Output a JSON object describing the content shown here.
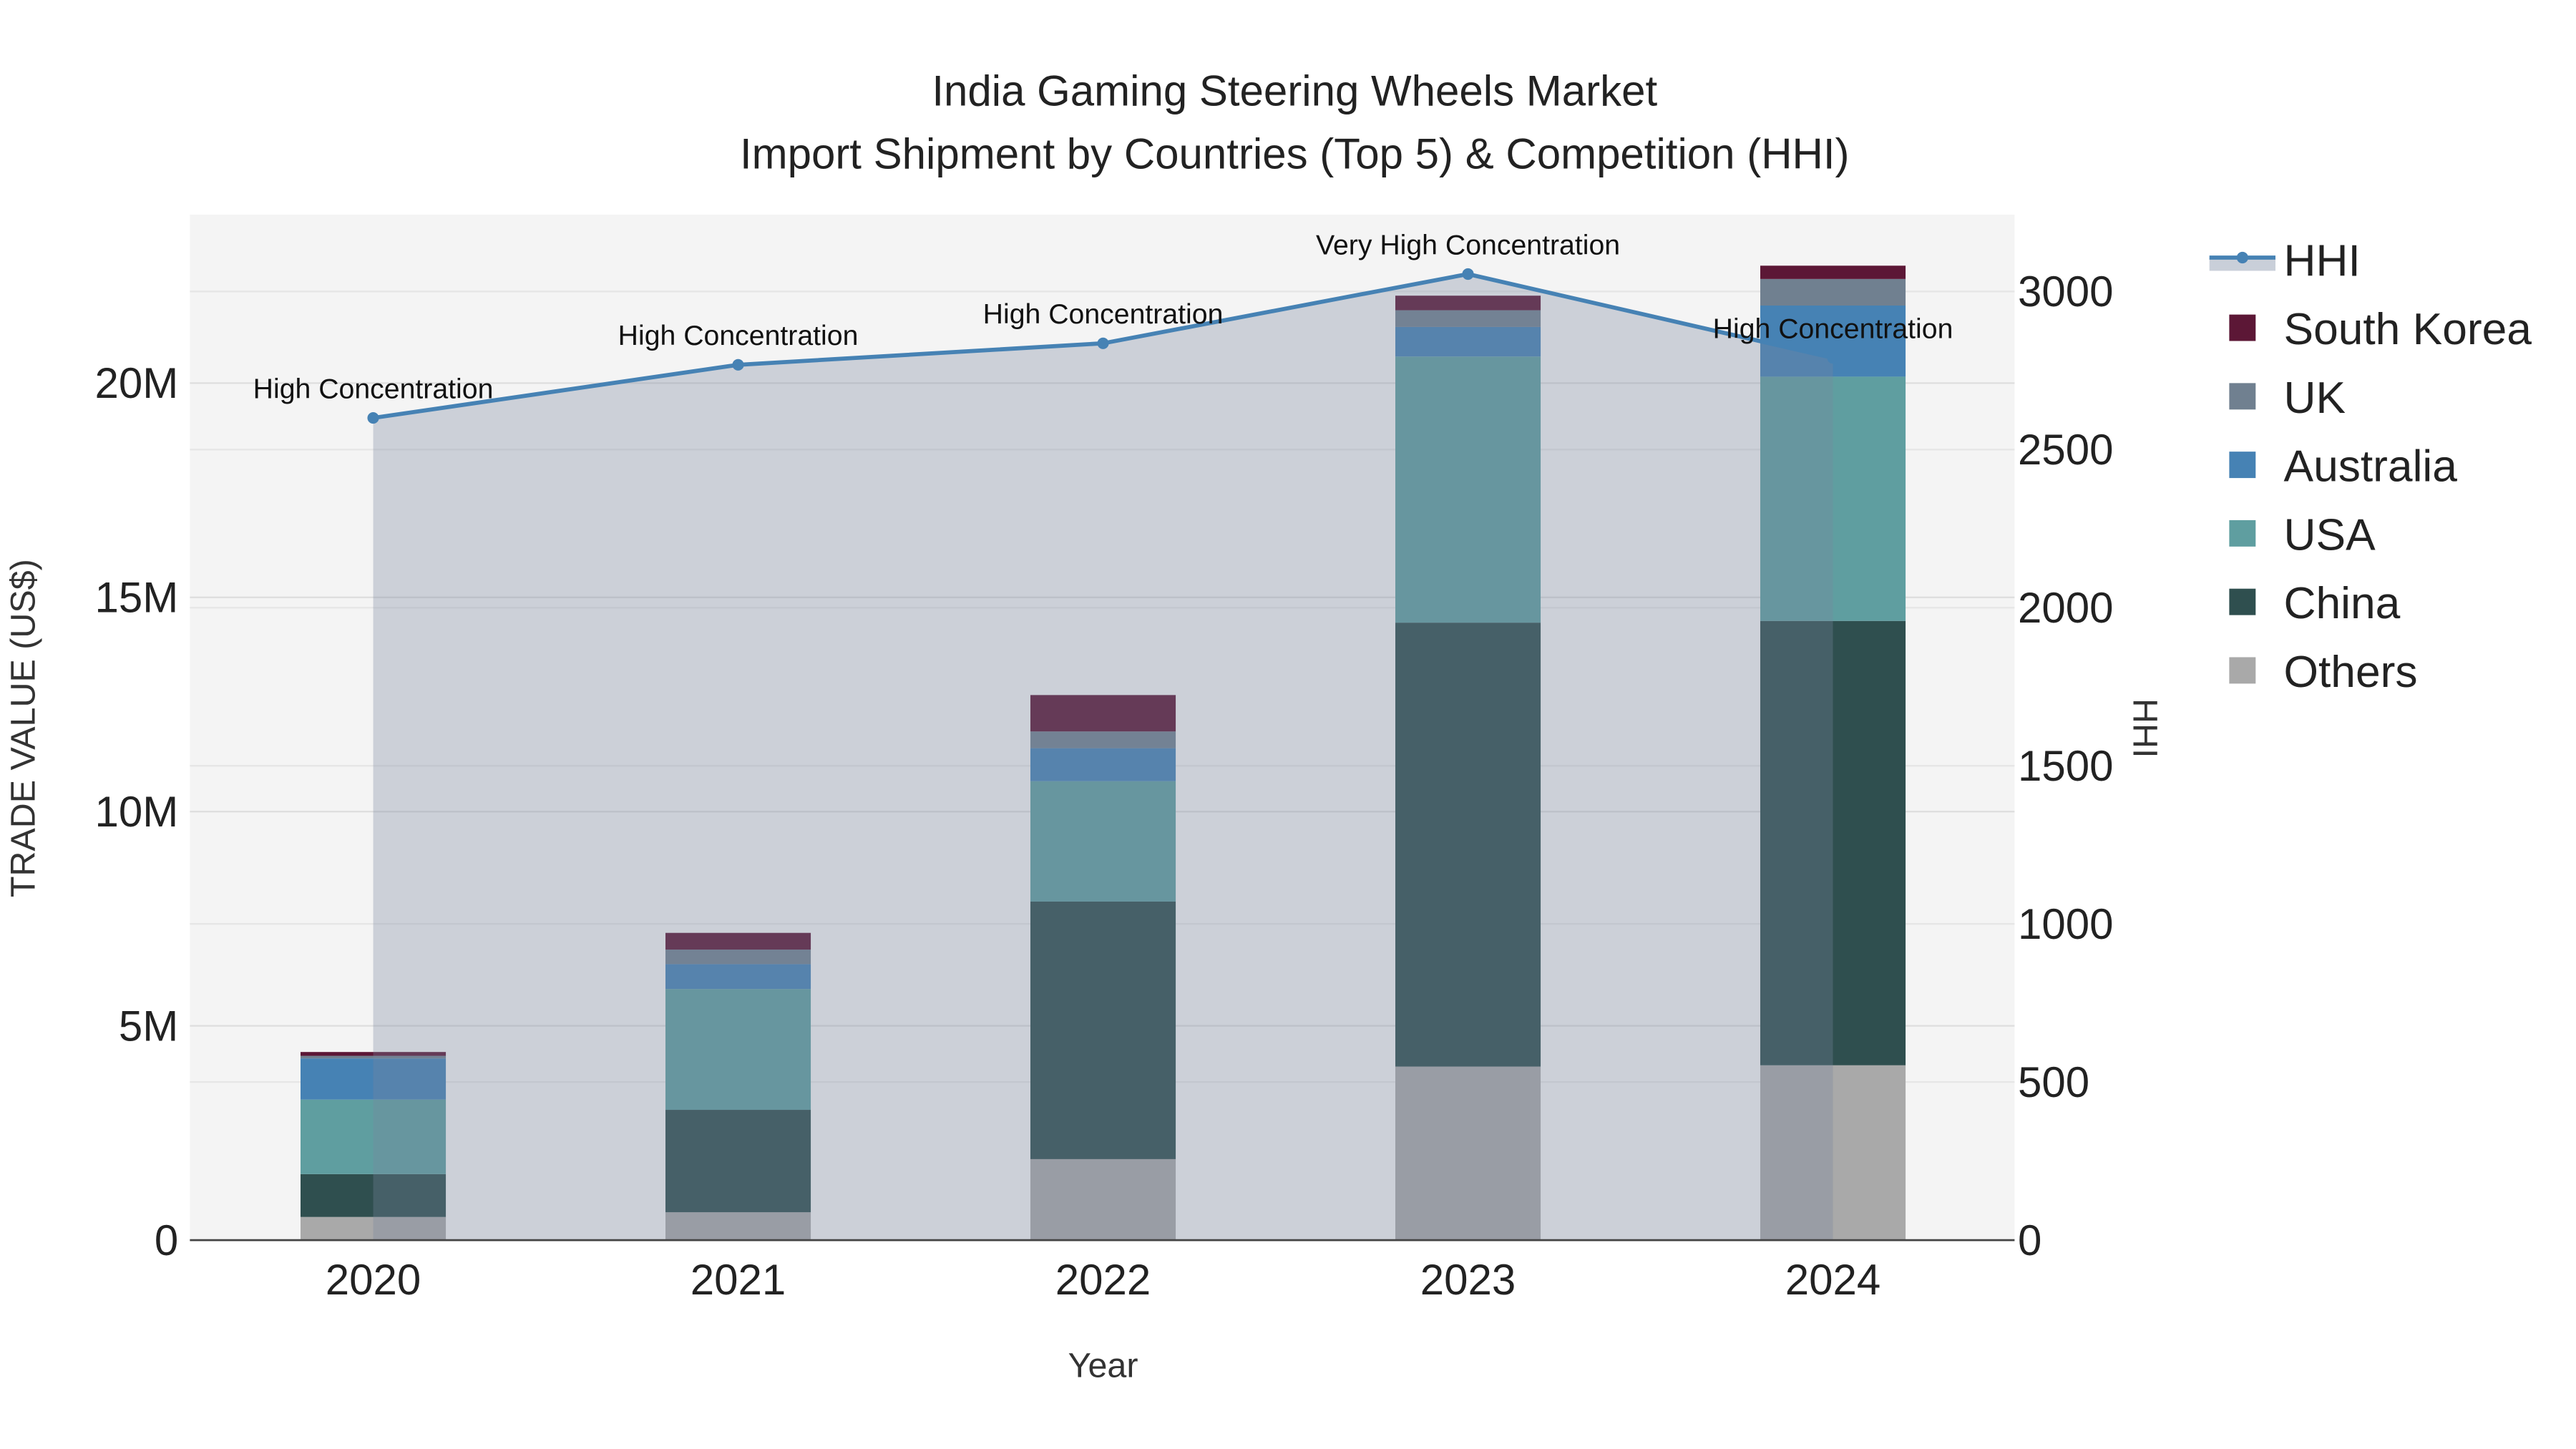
{
  "chart_data": {
    "type": "bar",
    "stacked": true,
    "title": "India Gaming Steering Wheels Market",
    "subtitle": "Import Shipment by Countries (Top 5) & Competition (HHI)",
    "xlabel": "Year",
    "ylabel": "TRADE VALUE (US$)",
    "y2label": "HHI",
    "categories": [
      "2020",
      "2021",
      "2022",
      "2023",
      "2024"
    ],
    "ylim": [
      0,
      23900000
    ],
    "y2lim": [
      0,
      3250
    ],
    "yticks": [
      {
        "v": 0,
        "label": "0"
      },
      {
        "v": 5000000,
        "label": "5M"
      },
      {
        "v": 10000000,
        "label": "10M"
      },
      {
        "v": 15000000,
        "label": "15M"
      },
      {
        "v": 20000000,
        "label": "20M"
      }
    ],
    "y2ticks": [
      0,
      500,
      1000,
      1500,
      2000,
      2500,
      3000
    ],
    "series": [
      {
        "name": "Others",
        "color": "#a9a9a9",
        "values": [
          540000,
          650000,
          1890000,
          4050000,
          4080000
        ]
      },
      {
        "name": "China",
        "color": "#2f4f4f",
        "values": [
          1000000,
          2390000,
          6010000,
          10360000,
          10370000
        ]
      },
      {
        "name": "USA",
        "color": "#5f9ea0",
        "values": [
          1740000,
          2820000,
          2810000,
          6210000,
          5700000
        ]
      },
      {
        "name": "Australia",
        "color": "#4682b4",
        "values": [
          960000,
          580000,
          770000,
          690000,
          1660000
        ]
      },
      {
        "name": "UK",
        "color": "#708090",
        "values": [
          60000,
          340000,
          390000,
          390000,
          620000
        ]
      },
      {
        "name": "South Korea",
        "color": "#5c1736",
        "values": [
          90000,
          390000,
          850000,
          340000,
          310000
        ]
      }
    ],
    "line": {
      "name": "HHI",
      "color": "#4682b4",
      "values": [
        2600,
        2768,
        2836,
        3055,
        2790
      ],
      "annotations": [
        "High Concentration",
        "High Concentration",
        "High Concentration",
        "Very High Concentration",
        "High Concentration"
      ]
    },
    "legend": [
      "HHI",
      "South Korea",
      "UK",
      "Australia",
      "USA",
      "China",
      "Others"
    ],
    "legend_position": "right",
    "grid": true
  }
}
